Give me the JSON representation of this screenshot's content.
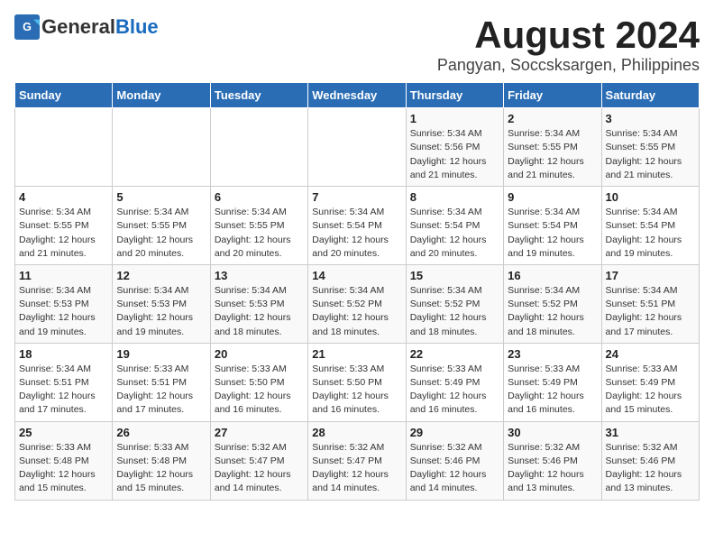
{
  "logo": {
    "general": "General",
    "blue": "Blue"
  },
  "title": "August 2024",
  "subtitle": "Pangyan, Soccsksargen, Philippines",
  "weekdays": [
    "Sunday",
    "Monday",
    "Tuesday",
    "Wednesday",
    "Thursday",
    "Friday",
    "Saturday"
  ],
  "weeks": [
    [
      {
        "day": "",
        "info": ""
      },
      {
        "day": "",
        "info": ""
      },
      {
        "day": "",
        "info": ""
      },
      {
        "day": "",
        "info": ""
      },
      {
        "day": "1",
        "info": "Sunrise: 5:34 AM\nSunset: 5:56 PM\nDaylight: 12 hours\nand 21 minutes."
      },
      {
        "day": "2",
        "info": "Sunrise: 5:34 AM\nSunset: 5:55 PM\nDaylight: 12 hours\nand 21 minutes."
      },
      {
        "day": "3",
        "info": "Sunrise: 5:34 AM\nSunset: 5:55 PM\nDaylight: 12 hours\nand 21 minutes."
      }
    ],
    [
      {
        "day": "4",
        "info": "Sunrise: 5:34 AM\nSunset: 5:55 PM\nDaylight: 12 hours\nand 21 minutes."
      },
      {
        "day": "5",
        "info": "Sunrise: 5:34 AM\nSunset: 5:55 PM\nDaylight: 12 hours\nand 20 minutes."
      },
      {
        "day": "6",
        "info": "Sunrise: 5:34 AM\nSunset: 5:55 PM\nDaylight: 12 hours\nand 20 minutes."
      },
      {
        "day": "7",
        "info": "Sunrise: 5:34 AM\nSunset: 5:54 PM\nDaylight: 12 hours\nand 20 minutes."
      },
      {
        "day": "8",
        "info": "Sunrise: 5:34 AM\nSunset: 5:54 PM\nDaylight: 12 hours\nand 20 minutes."
      },
      {
        "day": "9",
        "info": "Sunrise: 5:34 AM\nSunset: 5:54 PM\nDaylight: 12 hours\nand 19 minutes."
      },
      {
        "day": "10",
        "info": "Sunrise: 5:34 AM\nSunset: 5:54 PM\nDaylight: 12 hours\nand 19 minutes."
      }
    ],
    [
      {
        "day": "11",
        "info": "Sunrise: 5:34 AM\nSunset: 5:53 PM\nDaylight: 12 hours\nand 19 minutes."
      },
      {
        "day": "12",
        "info": "Sunrise: 5:34 AM\nSunset: 5:53 PM\nDaylight: 12 hours\nand 19 minutes."
      },
      {
        "day": "13",
        "info": "Sunrise: 5:34 AM\nSunset: 5:53 PM\nDaylight: 12 hours\nand 18 minutes."
      },
      {
        "day": "14",
        "info": "Sunrise: 5:34 AM\nSunset: 5:52 PM\nDaylight: 12 hours\nand 18 minutes."
      },
      {
        "day": "15",
        "info": "Sunrise: 5:34 AM\nSunset: 5:52 PM\nDaylight: 12 hours\nand 18 minutes."
      },
      {
        "day": "16",
        "info": "Sunrise: 5:34 AM\nSunset: 5:52 PM\nDaylight: 12 hours\nand 18 minutes."
      },
      {
        "day": "17",
        "info": "Sunrise: 5:34 AM\nSunset: 5:51 PM\nDaylight: 12 hours\nand 17 minutes."
      }
    ],
    [
      {
        "day": "18",
        "info": "Sunrise: 5:34 AM\nSunset: 5:51 PM\nDaylight: 12 hours\nand 17 minutes."
      },
      {
        "day": "19",
        "info": "Sunrise: 5:33 AM\nSunset: 5:51 PM\nDaylight: 12 hours\nand 17 minutes."
      },
      {
        "day": "20",
        "info": "Sunrise: 5:33 AM\nSunset: 5:50 PM\nDaylight: 12 hours\nand 16 minutes."
      },
      {
        "day": "21",
        "info": "Sunrise: 5:33 AM\nSunset: 5:50 PM\nDaylight: 12 hours\nand 16 minutes."
      },
      {
        "day": "22",
        "info": "Sunrise: 5:33 AM\nSunset: 5:49 PM\nDaylight: 12 hours\nand 16 minutes."
      },
      {
        "day": "23",
        "info": "Sunrise: 5:33 AM\nSunset: 5:49 PM\nDaylight: 12 hours\nand 16 minutes."
      },
      {
        "day": "24",
        "info": "Sunrise: 5:33 AM\nSunset: 5:49 PM\nDaylight: 12 hours\nand 15 minutes."
      }
    ],
    [
      {
        "day": "25",
        "info": "Sunrise: 5:33 AM\nSunset: 5:48 PM\nDaylight: 12 hours\nand 15 minutes."
      },
      {
        "day": "26",
        "info": "Sunrise: 5:33 AM\nSunset: 5:48 PM\nDaylight: 12 hours\nand 15 minutes."
      },
      {
        "day": "27",
        "info": "Sunrise: 5:32 AM\nSunset: 5:47 PM\nDaylight: 12 hours\nand 14 minutes."
      },
      {
        "day": "28",
        "info": "Sunrise: 5:32 AM\nSunset: 5:47 PM\nDaylight: 12 hours\nand 14 minutes."
      },
      {
        "day": "29",
        "info": "Sunrise: 5:32 AM\nSunset: 5:46 PM\nDaylight: 12 hours\nand 14 minutes."
      },
      {
        "day": "30",
        "info": "Sunrise: 5:32 AM\nSunset: 5:46 PM\nDaylight: 12 hours\nand 13 minutes."
      },
      {
        "day": "31",
        "info": "Sunrise: 5:32 AM\nSunset: 5:46 PM\nDaylight: 12 hours\nand 13 minutes."
      }
    ]
  ]
}
